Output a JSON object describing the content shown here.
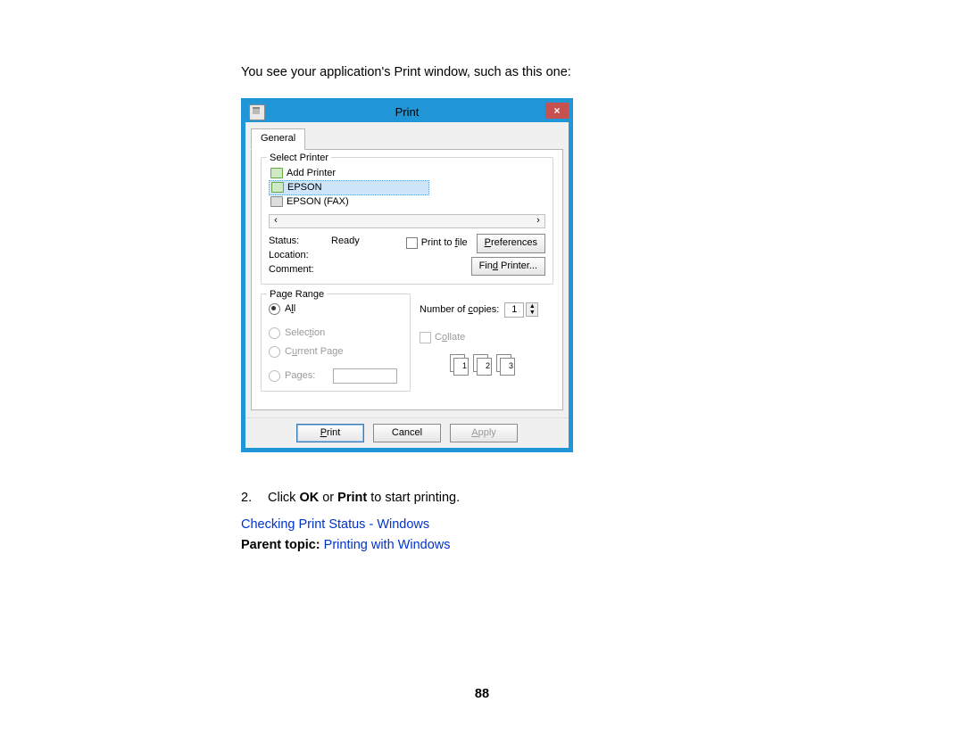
{
  "intro": "You see your application's Print window, such as this one:",
  "dialog": {
    "title": "Print",
    "close": "×",
    "tab": "General",
    "selectPrinter": {
      "label": "Select Printer",
      "items": [
        "Add Printer",
        "EPSON",
        "EPSON (FAX)"
      ],
      "selectedIndex": 1,
      "scroll": {
        "left": "‹",
        "right": "›"
      },
      "statusLabel": "Status:",
      "statusValue": "Ready",
      "locationLabel": "Location:",
      "commentLabel": "Comment:",
      "printToFile_pre": "Print to ",
      "printToFile_u": "f",
      "printToFile_post": "ile",
      "prefs_u": "P",
      "prefs_post": "references",
      "find_pre": "Fin",
      "find_u": "d",
      "find_post": " Printer..."
    },
    "pageRange": {
      "label": "Page Range",
      "all_u": "l",
      "all_pre": "A",
      "all_post": "l",
      "sel_pre": "Selec",
      "sel_u": "t",
      "sel_post": "ion",
      "cur_pre": "C",
      "cur_u": "u",
      "cur_post": "rrent Page",
      "pages_pre": "Pa",
      "pages_u": "g",
      "pages_post": "es:"
    },
    "copies": {
      "label_pre": "Number of ",
      "label_u": "c",
      "label_post": "opies:",
      "value": "1",
      "collate_pre": "C",
      "collate_u": "o",
      "collate_post": "llate",
      "stacks": [
        "1",
        "2",
        "3"
      ]
    },
    "buttons": {
      "print_u": "P",
      "print_post": "rint",
      "cancel": "Cancel",
      "apply_u": "A",
      "apply_post": "pply"
    }
  },
  "step": {
    "num": "2.",
    "pre": "Click ",
    "b1": "OK",
    "mid": " or ",
    "b2": "Print",
    "post": " to start printing."
  },
  "link1": "Checking Print Status - Windows",
  "parentLabel": "Parent topic:",
  "parentLink": "Printing with Windows",
  "pageNumber": "88"
}
